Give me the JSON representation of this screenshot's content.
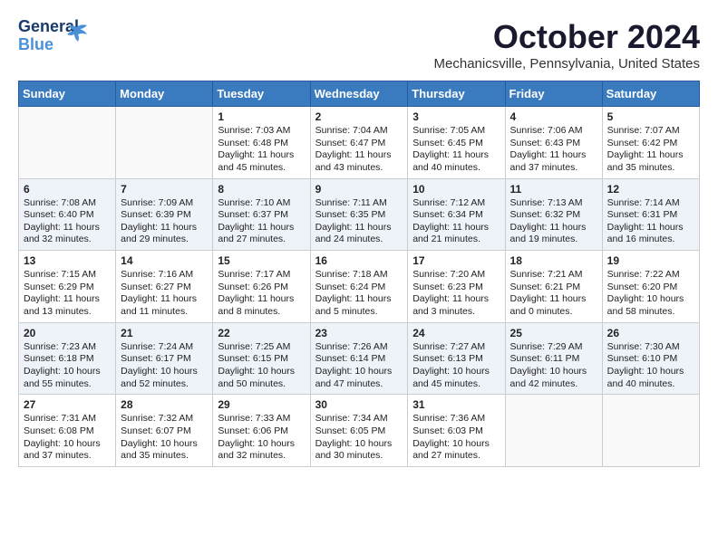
{
  "header": {
    "logo_line1": "General",
    "logo_line2": "Blue",
    "month": "October 2024",
    "location": "Mechanicsville, Pennsylvania, United States"
  },
  "days_of_week": [
    "Sunday",
    "Monday",
    "Tuesday",
    "Wednesday",
    "Thursday",
    "Friday",
    "Saturday"
  ],
  "weeks": [
    [
      {
        "day": "",
        "content": ""
      },
      {
        "day": "",
        "content": ""
      },
      {
        "day": "1",
        "content": "Sunrise: 7:03 AM\nSunset: 6:48 PM\nDaylight: 11 hours and 45 minutes."
      },
      {
        "day": "2",
        "content": "Sunrise: 7:04 AM\nSunset: 6:47 PM\nDaylight: 11 hours and 43 minutes."
      },
      {
        "day": "3",
        "content": "Sunrise: 7:05 AM\nSunset: 6:45 PM\nDaylight: 11 hours and 40 minutes."
      },
      {
        "day": "4",
        "content": "Sunrise: 7:06 AM\nSunset: 6:43 PM\nDaylight: 11 hours and 37 minutes."
      },
      {
        "day": "5",
        "content": "Sunrise: 7:07 AM\nSunset: 6:42 PM\nDaylight: 11 hours and 35 minutes."
      }
    ],
    [
      {
        "day": "6",
        "content": "Sunrise: 7:08 AM\nSunset: 6:40 PM\nDaylight: 11 hours and 32 minutes."
      },
      {
        "day": "7",
        "content": "Sunrise: 7:09 AM\nSunset: 6:39 PM\nDaylight: 11 hours and 29 minutes."
      },
      {
        "day": "8",
        "content": "Sunrise: 7:10 AM\nSunset: 6:37 PM\nDaylight: 11 hours and 27 minutes."
      },
      {
        "day": "9",
        "content": "Sunrise: 7:11 AM\nSunset: 6:35 PM\nDaylight: 11 hours and 24 minutes."
      },
      {
        "day": "10",
        "content": "Sunrise: 7:12 AM\nSunset: 6:34 PM\nDaylight: 11 hours and 21 minutes."
      },
      {
        "day": "11",
        "content": "Sunrise: 7:13 AM\nSunset: 6:32 PM\nDaylight: 11 hours and 19 minutes."
      },
      {
        "day": "12",
        "content": "Sunrise: 7:14 AM\nSunset: 6:31 PM\nDaylight: 11 hours and 16 minutes."
      }
    ],
    [
      {
        "day": "13",
        "content": "Sunrise: 7:15 AM\nSunset: 6:29 PM\nDaylight: 11 hours and 13 minutes."
      },
      {
        "day": "14",
        "content": "Sunrise: 7:16 AM\nSunset: 6:27 PM\nDaylight: 11 hours and 11 minutes."
      },
      {
        "day": "15",
        "content": "Sunrise: 7:17 AM\nSunset: 6:26 PM\nDaylight: 11 hours and 8 minutes."
      },
      {
        "day": "16",
        "content": "Sunrise: 7:18 AM\nSunset: 6:24 PM\nDaylight: 11 hours and 5 minutes."
      },
      {
        "day": "17",
        "content": "Sunrise: 7:20 AM\nSunset: 6:23 PM\nDaylight: 11 hours and 3 minutes."
      },
      {
        "day": "18",
        "content": "Sunrise: 7:21 AM\nSunset: 6:21 PM\nDaylight: 11 hours and 0 minutes."
      },
      {
        "day": "19",
        "content": "Sunrise: 7:22 AM\nSunset: 6:20 PM\nDaylight: 10 hours and 58 minutes."
      }
    ],
    [
      {
        "day": "20",
        "content": "Sunrise: 7:23 AM\nSunset: 6:18 PM\nDaylight: 10 hours and 55 minutes."
      },
      {
        "day": "21",
        "content": "Sunrise: 7:24 AM\nSunset: 6:17 PM\nDaylight: 10 hours and 52 minutes."
      },
      {
        "day": "22",
        "content": "Sunrise: 7:25 AM\nSunset: 6:15 PM\nDaylight: 10 hours and 50 minutes."
      },
      {
        "day": "23",
        "content": "Sunrise: 7:26 AM\nSunset: 6:14 PM\nDaylight: 10 hours and 47 minutes."
      },
      {
        "day": "24",
        "content": "Sunrise: 7:27 AM\nSunset: 6:13 PM\nDaylight: 10 hours and 45 minutes."
      },
      {
        "day": "25",
        "content": "Sunrise: 7:29 AM\nSunset: 6:11 PM\nDaylight: 10 hours and 42 minutes."
      },
      {
        "day": "26",
        "content": "Sunrise: 7:30 AM\nSunset: 6:10 PM\nDaylight: 10 hours and 40 minutes."
      }
    ],
    [
      {
        "day": "27",
        "content": "Sunrise: 7:31 AM\nSunset: 6:08 PM\nDaylight: 10 hours and 37 minutes."
      },
      {
        "day": "28",
        "content": "Sunrise: 7:32 AM\nSunset: 6:07 PM\nDaylight: 10 hours and 35 minutes."
      },
      {
        "day": "29",
        "content": "Sunrise: 7:33 AM\nSunset: 6:06 PM\nDaylight: 10 hours and 32 minutes."
      },
      {
        "day": "30",
        "content": "Sunrise: 7:34 AM\nSunset: 6:05 PM\nDaylight: 10 hours and 30 minutes."
      },
      {
        "day": "31",
        "content": "Sunrise: 7:36 AM\nSunset: 6:03 PM\nDaylight: 10 hours and 27 minutes."
      },
      {
        "day": "",
        "content": ""
      },
      {
        "day": "",
        "content": ""
      }
    ]
  ]
}
